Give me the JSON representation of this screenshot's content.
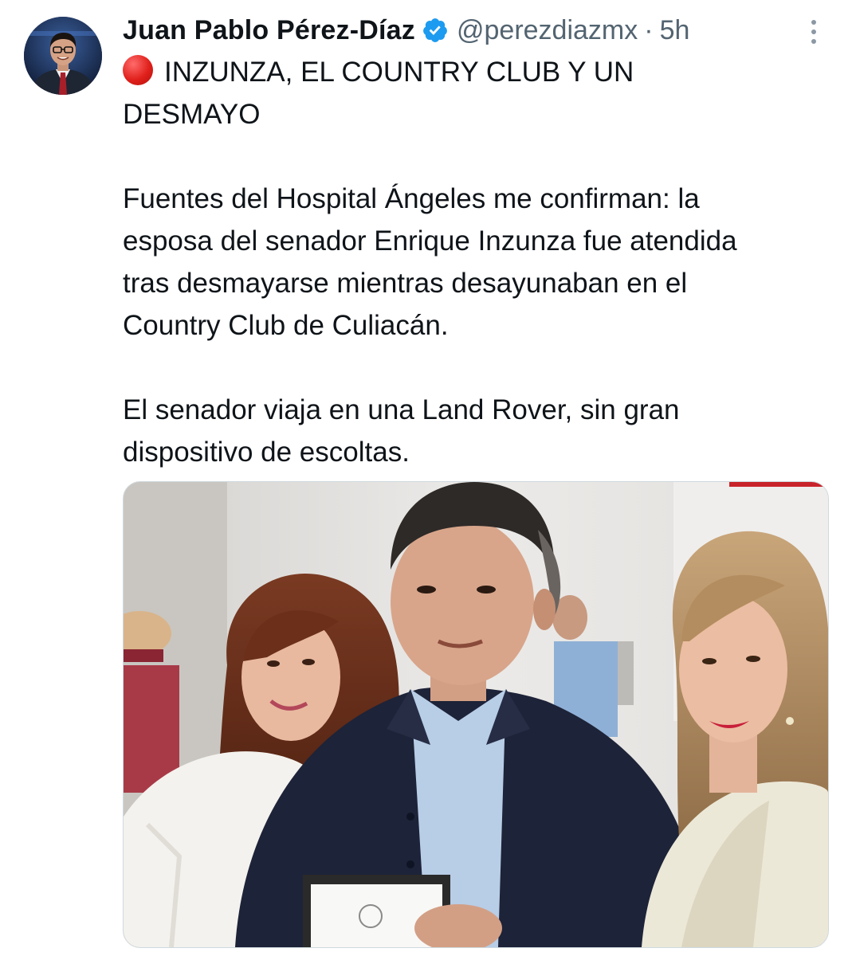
{
  "author": {
    "name": "Juan Pablo Pérez-Díaz",
    "handle": "@perezdiazmx",
    "separator": "·",
    "time": "5h",
    "verified": true,
    "verified_color": "#1d9bf0"
  },
  "icons": {
    "avatar": "avatar-image",
    "verified": "verified-badge-icon",
    "more": "more-options-icon",
    "red_circle": "red-circle-emoji-icon"
  },
  "tweet": {
    "headline_line1": "INZUNZA, EL COUNTRY CLUB Y UN",
    "headline_line2": "DESMAYO",
    "p1_line1": "Fuentes del Hospital Ángeles me confirman: la",
    "p1_line2": "esposa del senador Enrique Inzunza fue atendida",
    "p1_line3": "tras desmayarse mientras desayunaban en el",
    "p1_line4": "Country Club de Culiacán.",
    "p2_line1": "El senador viaja en una Land Rover, sin gran",
    "p2_line2": "dispositivo de escoltas."
  },
  "media": {
    "type": "photo"
  },
  "colors": {
    "text_primary": "#0f1419",
    "text_secondary": "#536471",
    "accent_red": "#e0201b"
  }
}
